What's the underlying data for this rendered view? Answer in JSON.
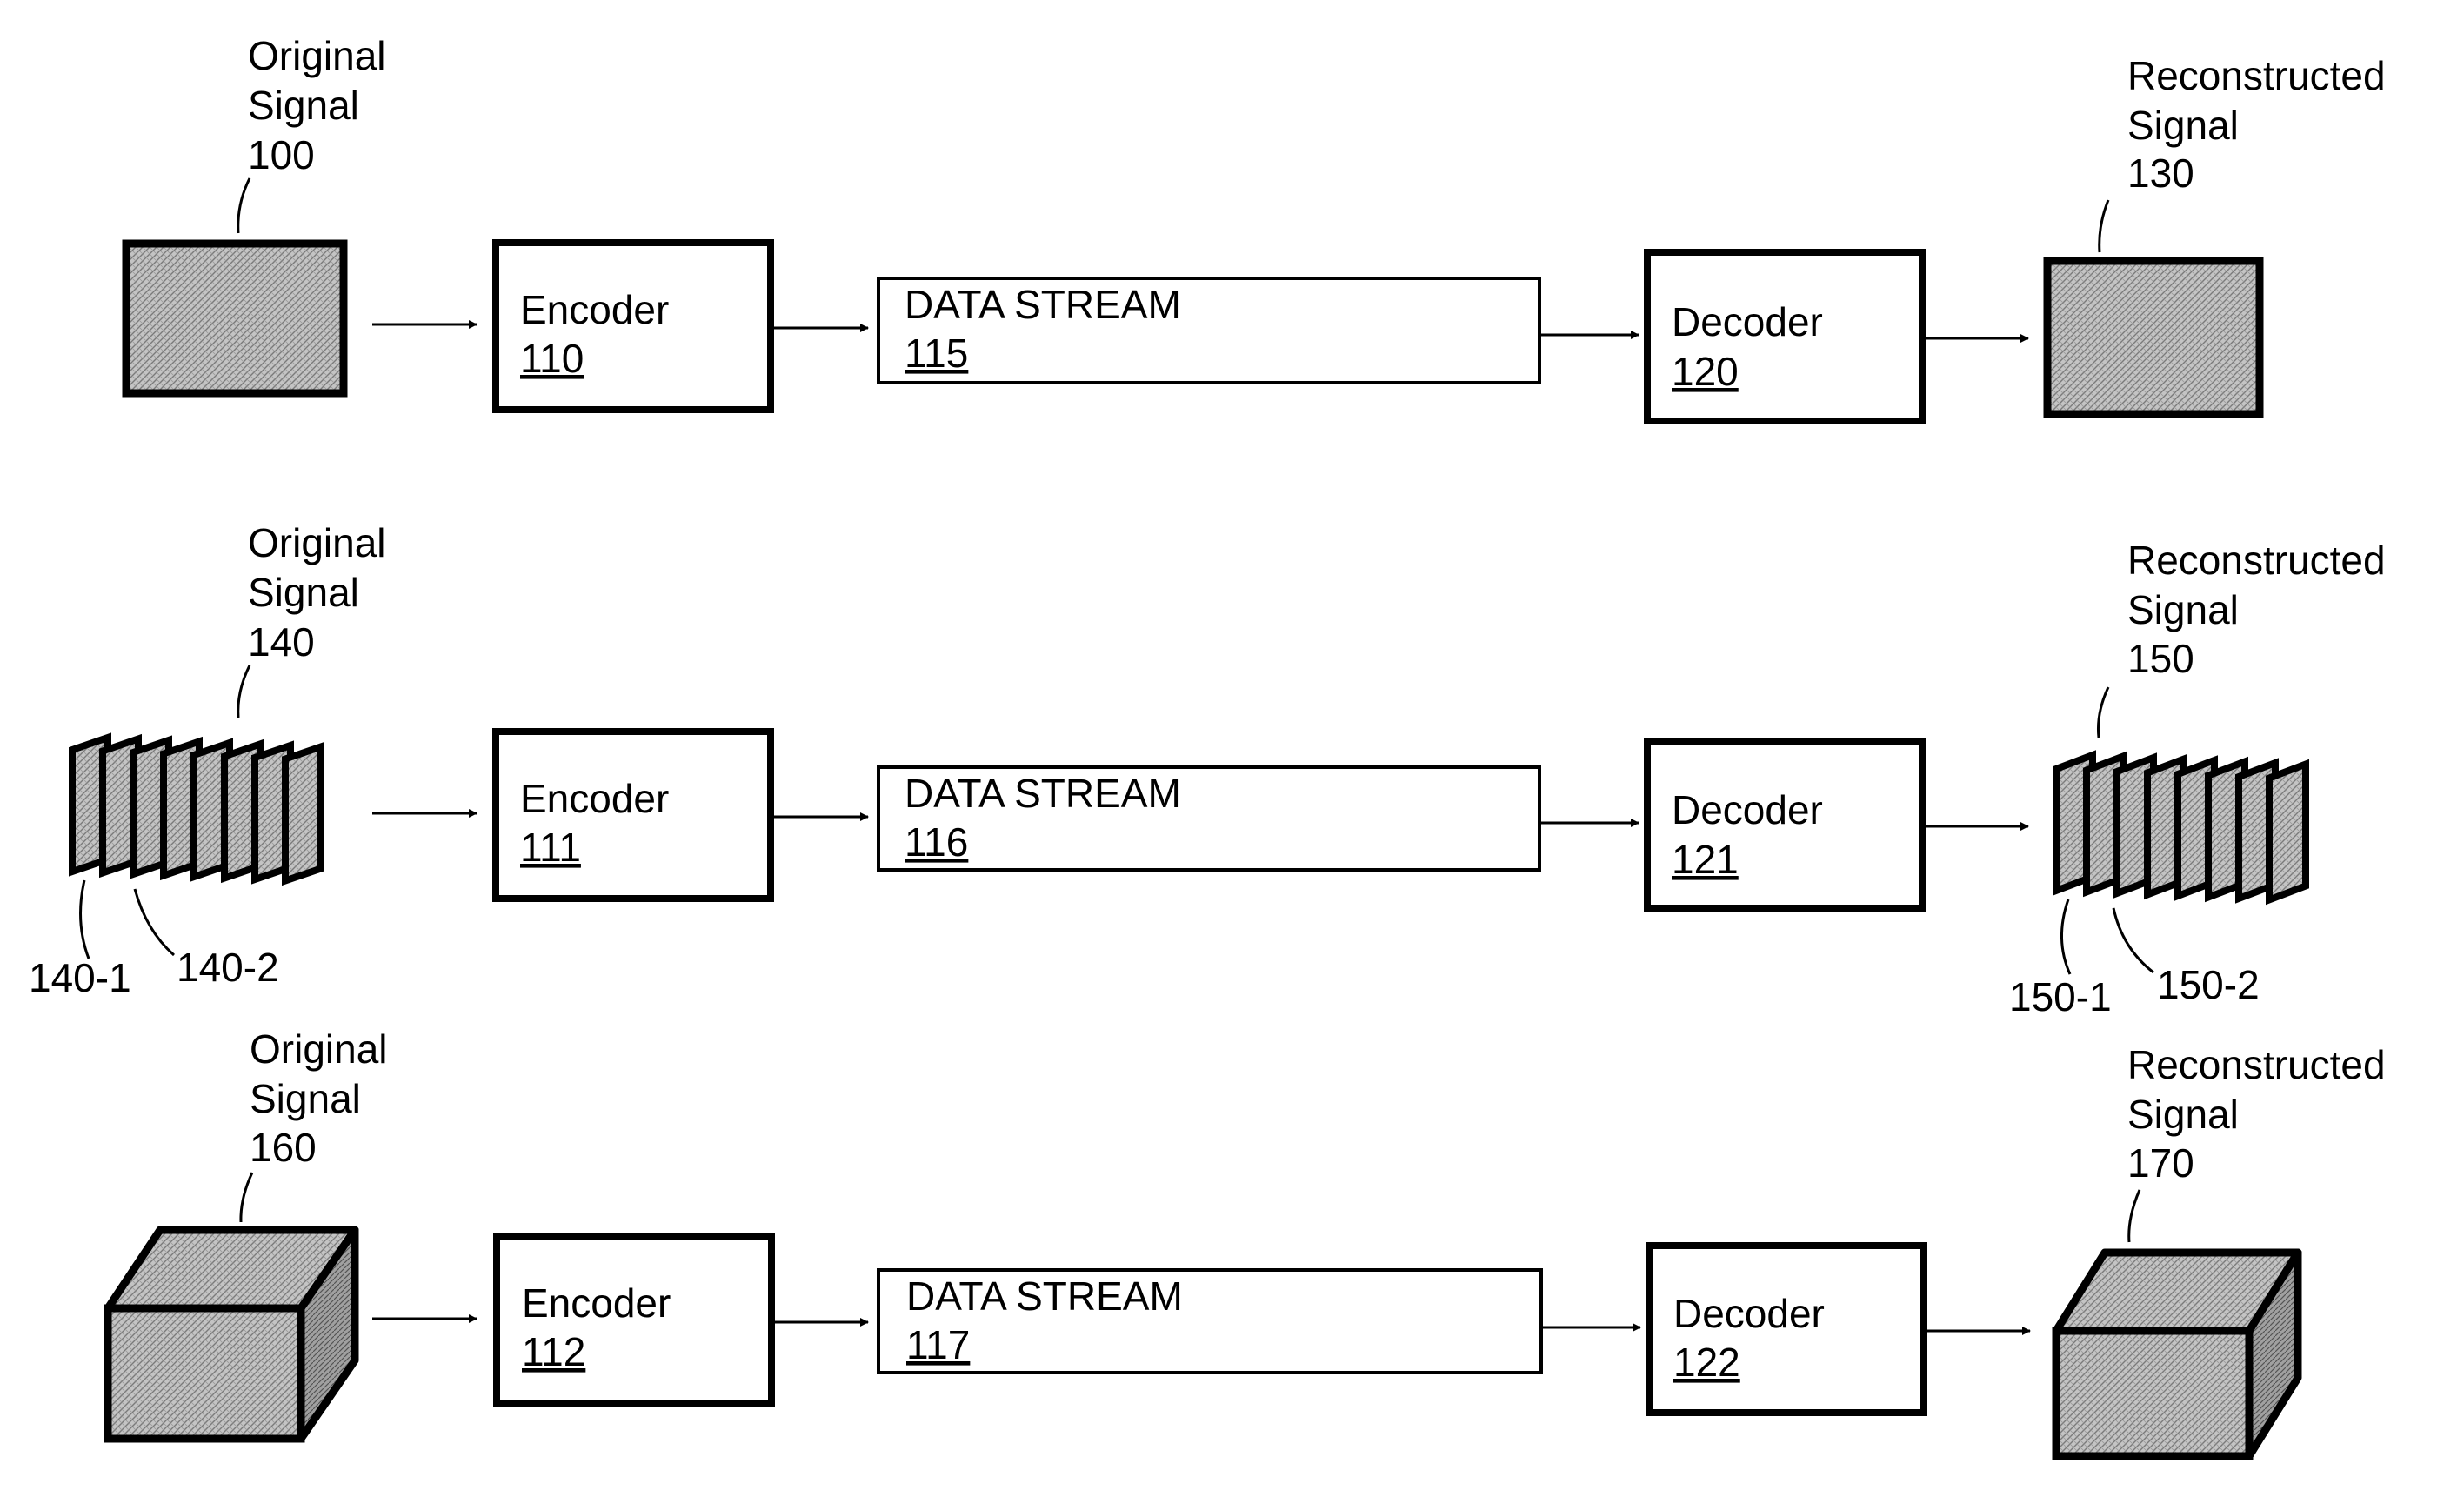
{
  "figure": {
    "rows": [
      {
        "original": {
          "line1": "Original",
          "line2": "Signal",
          "ref": "100",
          "shape": "rectangle"
        },
        "encoder": {
          "label": "Encoder",
          "ref": "110"
        },
        "stream": {
          "label": "DATA STREAM",
          "ref": "115"
        },
        "decoder": {
          "label": "Decoder",
          "ref": "120"
        },
        "reconstructed": {
          "line1": "Reconstructed",
          "line2": "Signal",
          "ref": "130",
          "shape": "rectangle"
        }
      },
      {
        "original": {
          "line1": "Original",
          "line2": "Signal",
          "ref": "140",
          "shape": "frame-stack",
          "frame_count": 8,
          "frame_refs": [
            "140-1",
            "140-2"
          ]
        },
        "encoder": {
          "label": "Encoder",
          "ref": "111"
        },
        "stream": {
          "label": "DATA STREAM",
          "ref": "116"
        },
        "decoder": {
          "label": "Decoder",
          "ref": "121"
        },
        "reconstructed": {
          "line1": "Reconstructed",
          "line2": "Signal",
          "ref": "150",
          "shape": "frame-stack",
          "frame_count": 8,
          "frame_refs": [
            "150-1",
            "150-2"
          ]
        }
      },
      {
        "original": {
          "line1": "Original",
          "line2": "Signal",
          "ref": "160",
          "shape": "cube"
        },
        "encoder": {
          "label": "Encoder",
          "ref": "112"
        },
        "stream": {
          "label": "DATA STREAM",
          "ref": "117"
        },
        "decoder": {
          "label": "Decoder",
          "ref": "122"
        },
        "reconstructed": {
          "line1": "Reconstructed",
          "line2": "Signal",
          "ref": "170",
          "shape": "cube"
        }
      }
    ],
    "colors": {
      "ink": "#000000",
      "fill_texture": "#b8b8b8",
      "fill_side": "#8c8c8c",
      "background": "#ffffff"
    }
  }
}
